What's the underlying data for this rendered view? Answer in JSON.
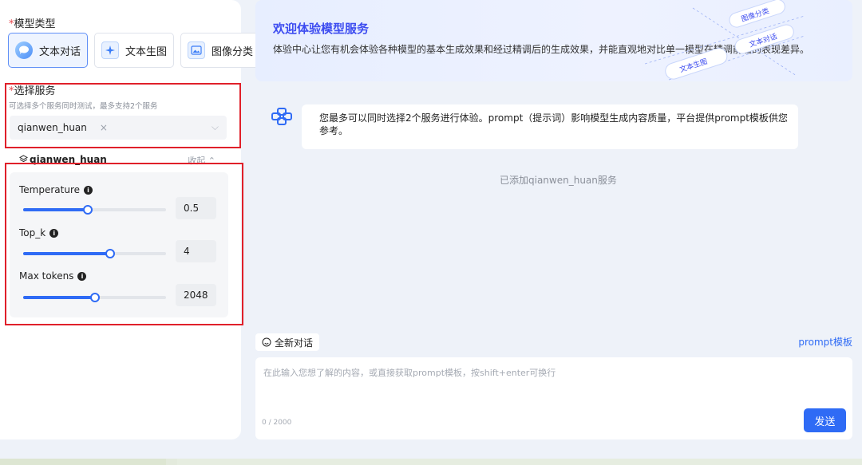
{
  "model_type": {
    "required_mark": "*",
    "label": "模型类型",
    "options": [
      {
        "label": "文本对话",
        "icon": "chat-bubble-icon",
        "active": true
      },
      {
        "label": "文本生图",
        "icon": "image-sparkle-icon",
        "active": false
      },
      {
        "label": "图像分类",
        "icon": "image-classify-icon",
        "active": false
      }
    ]
  },
  "service_select": {
    "required_mark": "*",
    "label": "选择服务",
    "hint": "可选择多个服务同时测试，最多支持2个服务",
    "selected_tag": "qianwen_huan",
    "tag_close": "×",
    "chevron": "⌵"
  },
  "service_params": {
    "name": "qianwen_huan",
    "collapse_label": "收起 ⌃",
    "params": [
      {
        "label": "Temperature",
        "value": "0.5",
        "fill": 0.45
      },
      {
        "label": "Top_k",
        "value": "4",
        "fill": 0.61
      },
      {
        "label": "Max tokens",
        "value": "2048",
        "fill": 0.5
      }
    ]
  },
  "banner": {
    "title": "欢迎体验模型服务",
    "description": "体验中心让您有机会体验各种模型的基本生成效果和经过精调后的生成效果，并能直观地对比单一模型在精调前后的表现差异。",
    "art_labels": [
      "图像分类",
      "文本对话",
      "文本生图"
    ]
  },
  "chat": {
    "assistant_message": "您最多可以同时选择2个服务进行体验。prompt（提示词）影响模型生成内容质量，平台提供prompt模板供您参考。",
    "added_notice": "已添加qianwen_huan服务",
    "new_chat_label": "全新对话",
    "prompt_template_link": "prompt模板",
    "input_placeholder": "在此输入您想了解的内容，或直接获取prompt模板，按shift+enter可换行",
    "char_count": "0 / 2000",
    "send_label": "发送"
  },
  "colors": {
    "accent": "#2f6bf5",
    "highlight_box": "#e0202a",
    "banner_title": "#3d4cf0"
  }
}
